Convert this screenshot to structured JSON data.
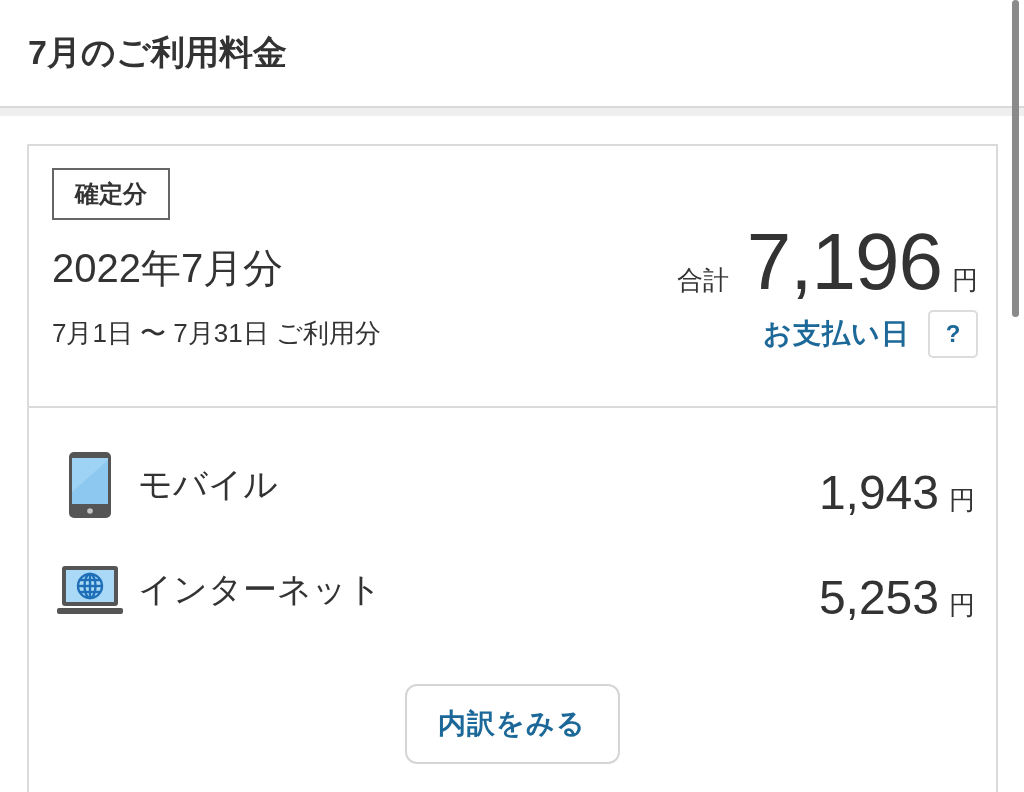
{
  "header": {
    "title": "7月のご利用料金"
  },
  "bill": {
    "status_badge": "確定分",
    "period": "2022年7月分",
    "date_range": "7月1日 〜 7月31日 ご利用分",
    "total": {
      "label": "合計",
      "amount": "7,196",
      "unit": "円"
    },
    "payment_date_link": "お支払い日",
    "help_button": "?"
  },
  "items": [
    {
      "kind": "mobile",
      "name": "モバイル",
      "amount": "1,943",
      "unit": "円"
    },
    {
      "kind": "internet",
      "name": "インターネット",
      "amount": "5,253",
      "unit": "円"
    }
  ],
  "details_button": "内訳をみる"
}
